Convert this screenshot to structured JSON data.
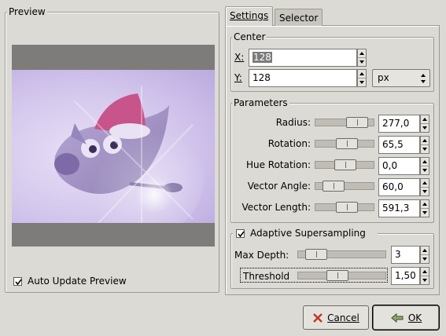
{
  "preview": {
    "title": "Preview",
    "auto_update_label": "Auto Update Preview",
    "auto_update_checked": true
  },
  "tabs": [
    {
      "label": "Settings",
      "active": true
    },
    {
      "label": "Selector",
      "active": false
    }
  ],
  "center": {
    "title": "Center",
    "x_label": "X:",
    "x_value": "128",
    "y_label": "Y:",
    "y_value": "128",
    "unit": "px"
  },
  "parameters": {
    "title": "Parameters",
    "rows": [
      {
        "label": "Radius:",
        "value": "277,0",
        "fraction": 0.82
      },
      {
        "label": "Rotation:",
        "value": "65,5",
        "fraction": 0.55
      },
      {
        "label": "Hue Rotation:",
        "value": "0,0",
        "fraction": 0.5
      },
      {
        "label": "Vector Angle:",
        "value": "60,0",
        "fraction": 0.18
      },
      {
        "label": "Vector Length:",
        "value": "591,3",
        "fraction": 0.55
      }
    ]
  },
  "supersampling": {
    "label": "Adaptive Supersampling",
    "checked": true,
    "max_depth_label": "Max Depth:",
    "max_depth_value": "3",
    "max_depth_fraction": 0.11,
    "threshold_label": "Threshold",
    "threshold_value": "1,50",
    "threshold_fraction": 0.42
  },
  "buttons": {
    "cancel": "Cancel",
    "ok": "OK"
  },
  "colors": {
    "background": "#dcdad5",
    "preview_bg": "#7d7c7a",
    "image_tint": "#d3c6ec"
  }
}
